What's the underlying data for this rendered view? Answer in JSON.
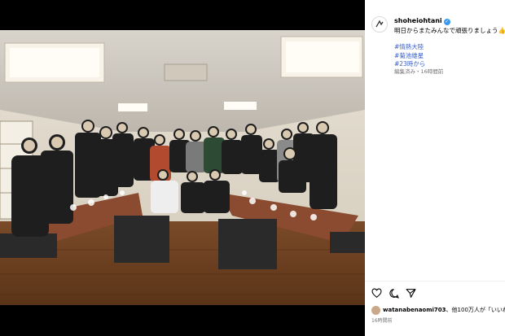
{
  "post": {
    "username": "shoheiohtani",
    "verified_mark": "✓",
    "caption": "明日からまたみんなで頑張りましょう👍",
    "hashtags": [
      "#情熱大陸",
      "#菊池雄星",
      "#23時から"
    ],
    "edited_time": "編集済み・16時間前",
    "likes_user": "watanabenaomi703",
    "likes_suffix": "、他100万人が「いいね",
    "time": "16時間前"
  },
  "icons": {
    "avatar": "logo-avatar-icon",
    "like": "heart-icon",
    "comment": "comment-icon",
    "share": "share-icon"
  },
  "colors": {
    "background": "#000000",
    "panel": "#ffffff",
    "hashtag": "#3b5fc7",
    "verified": "#3897f0",
    "secondary_text": "#737373"
  }
}
